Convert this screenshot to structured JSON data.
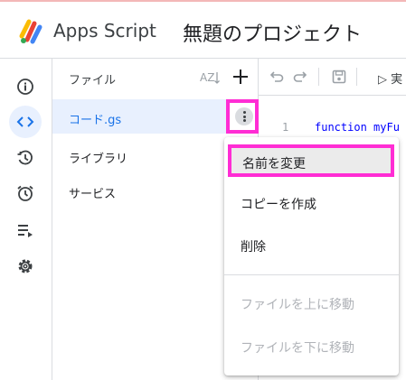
{
  "header": {
    "app_title": "Apps Script",
    "project_title": "無題のプロジェクト"
  },
  "rail": {
    "items": [
      {
        "icon": "info-icon"
      },
      {
        "icon": "code-icon",
        "active": true
      },
      {
        "icon": "history-icon"
      },
      {
        "icon": "alarm-icon"
      },
      {
        "icon": "executions-icon"
      },
      {
        "icon": "gear-icon"
      }
    ]
  },
  "files": {
    "label": "ファイル",
    "items": [
      {
        "name": "コード.gs",
        "selected": true
      },
      {
        "name": "ライブラリ"
      },
      {
        "name": "サービス"
      }
    ]
  },
  "toolbar": {
    "run_label": "▷ 実"
  },
  "editor": {
    "line_number": "1",
    "code": "function myFu"
  },
  "context_menu": {
    "items": [
      {
        "label": "名前を変更",
        "highlighted": true
      },
      {
        "label": "コピーを作成"
      },
      {
        "label": "削除"
      },
      {
        "label": "ファイルを上に移動",
        "disabled": true
      },
      {
        "label": "ファイルを下に移動",
        "disabled": true
      }
    ]
  },
  "colors": {
    "accent": "#1a73e8",
    "highlight_border": "#ff2dd4",
    "selected_bg": "#e8f0fe"
  }
}
